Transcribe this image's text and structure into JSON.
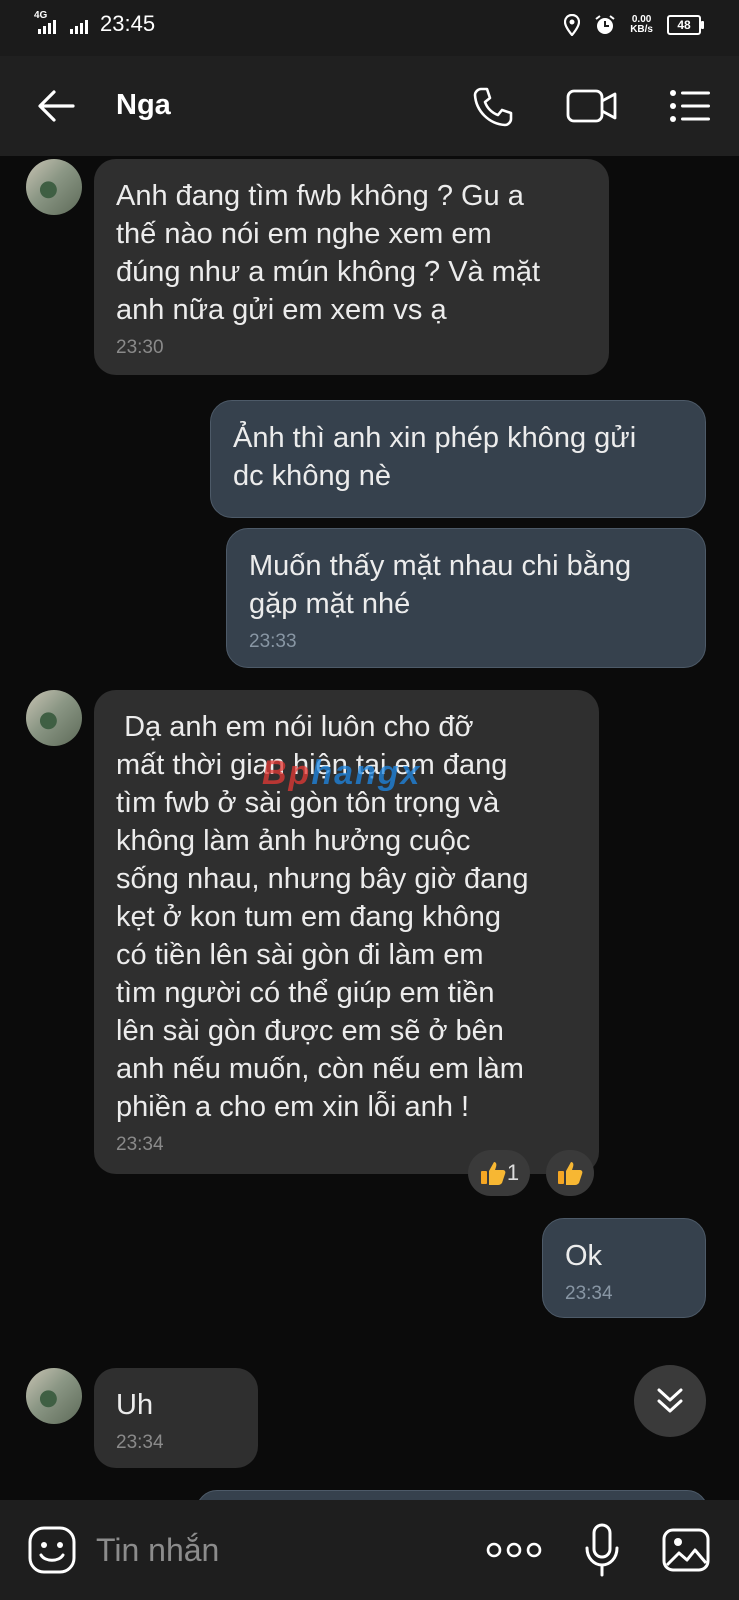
{
  "status_bar": {
    "network": "4G",
    "time": "23:45",
    "speed_value": "0.00",
    "speed_unit": "KB/s",
    "battery": "48",
    "icons": [
      "signal-icon",
      "location-icon",
      "alarm-icon",
      "battery-icon"
    ]
  },
  "header": {
    "title": "Nga",
    "icons": [
      "back-arrow-icon",
      "phone-icon",
      "video-camera-icon",
      "menu-icon"
    ]
  },
  "messages": [
    {
      "side": "in",
      "text": "Anh đang tìm fwb không ? Gu a\nthế nào nói em nghe xem em\nđúng như a mún không ? Và mặt\nanh nữa gửi em xem vs ạ",
      "time": "23:30"
    },
    {
      "side": "out",
      "text": "Ảnh thì anh xin phép không gửi\ndc không nè",
      "time": ""
    },
    {
      "side": "out",
      "text": "Muốn thấy mặt nhau chi bằng\ngặp mặt nhé",
      "time": "23:33"
    },
    {
      "side": "in",
      "text": " Dạ anh em nói luôn cho đỡ\nmất thời gian hiện tại em đang\ntìm fwb ở sài gòn tôn trọng và\nkhông làm ảnh hưởng cuộc\nsống nhau, nhưng bây giờ đang\nkẹt ở kon tum em đang không\ncó tiền lên sài gòn đi làm em\ntìm người có thể giúp em tiền\nlên sài gòn được em sẽ ở bên\nanh nếu muốn, còn nếu em làm\nphiền a cho em xin lỗi anh !",
      "time": "23:34"
    },
    {
      "side": "out",
      "text": "Ok",
      "time": "23:34"
    },
    {
      "side": "in",
      "text": "Uh",
      "time": "23:34"
    }
  ],
  "reactions": {
    "thumbs_count": "1"
  },
  "watermark": "Bphangx",
  "input_bar": {
    "placeholder": "Tin nhắn",
    "icons": [
      "emoji-icon",
      "more-dots-icon",
      "microphone-icon",
      "gallery-icon"
    ]
  },
  "colors": {
    "background": "#0b0b0b",
    "incoming_bubble": "#2f2f2f",
    "outgoing_bubble": "#36414d",
    "header": "#202020"
  }
}
